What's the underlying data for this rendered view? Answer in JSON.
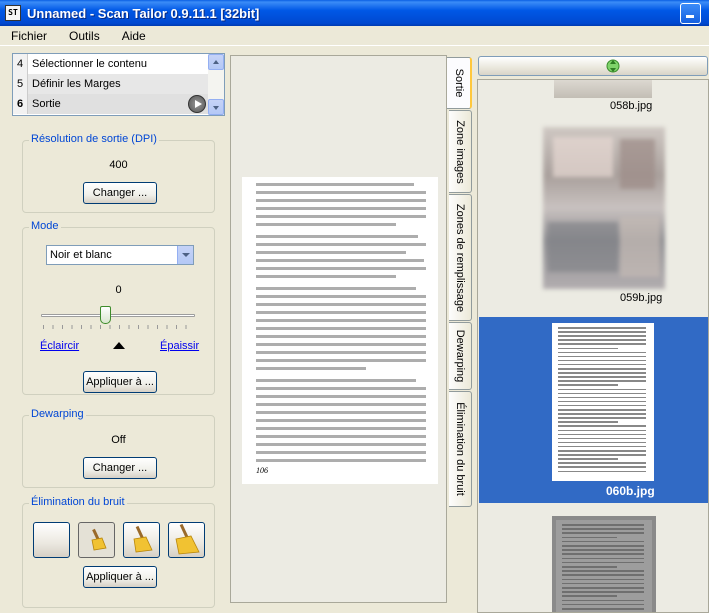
{
  "window": {
    "title": "Unnamed - Scan Tailor 0.9.11.1 [32bit]",
    "app_icon_text": "ST"
  },
  "menu": [
    "Fichier",
    "Outils",
    "Aide"
  ],
  "steps": [
    {
      "num": "4",
      "label": "Sélectionner le contenu"
    },
    {
      "num": "5",
      "label": "Définir les Marges"
    },
    {
      "num": "6",
      "label": "Sortie"
    }
  ],
  "resolution": {
    "title": "Résolution de sortie (DPI)",
    "value": "400",
    "button": "Changer ..."
  },
  "mode": {
    "title": "Mode",
    "selected": "Noir et blanc",
    "threshold_value": "0",
    "threshold_level": 0,
    "lighter_link": "Éclaircir",
    "thicker_link": "Épaissir",
    "apply_button": "Appliquer à ..."
  },
  "dewarping": {
    "title": "Dewarping",
    "value": "Off",
    "button": "Changer ..."
  },
  "noise": {
    "title": "Élimination du bruit",
    "apply_button": "Appliquer à ...",
    "selected_index": 1
  },
  "tabs": [
    "Sortie",
    "Zone images",
    "Zones de remplissage",
    "Dewarping",
    "Élimination du bruit"
  ],
  "page": {
    "number": "106"
  },
  "thumbnails": [
    {
      "caption": "058b.jpg"
    },
    {
      "caption": "059b.jpg"
    },
    {
      "caption": "060b.jpg",
      "selected": true
    }
  ],
  "colors": {
    "titlebar": "#0058e6",
    "group_title": "#0046d5",
    "selection": "#316ac5",
    "link": "#0000ee"
  }
}
